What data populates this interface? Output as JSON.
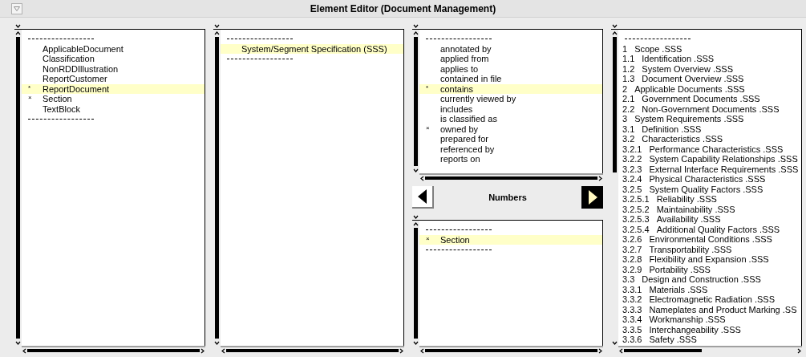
{
  "window": {
    "title": "Element Editor (Document Management)"
  },
  "element_list": {
    "items": [
      {
        "kind": "separator"
      },
      {
        "kind": "item",
        "text": "ApplicableDocument",
        "selected": false
      },
      {
        "kind": "item",
        "text": "Classification",
        "selected": false
      },
      {
        "kind": "item",
        "text": "NonRDDIllustration",
        "selected": false
      },
      {
        "kind": "item",
        "text": "ReportCustomer",
        "selected": false
      },
      {
        "kind": "item",
        "text": "ReportDocument",
        "marker": "*",
        "selected": true
      },
      {
        "kind": "item",
        "text": "Section",
        "marker": "×",
        "selected": false
      },
      {
        "kind": "item",
        "text": "TextBlock",
        "selected": false
      },
      {
        "kind": "separator"
      }
    ]
  },
  "instance_list": {
    "items": [
      {
        "kind": "separator"
      },
      {
        "kind": "item",
        "text": "System/Segment Specification (SSS)",
        "selected": true
      },
      {
        "kind": "separator"
      }
    ]
  },
  "relation_list": {
    "items": [
      {
        "kind": "separator"
      },
      {
        "kind": "item",
        "text": "annotated by",
        "selected": false
      },
      {
        "kind": "item",
        "text": "applied from",
        "selected": false
      },
      {
        "kind": "item",
        "text": "applies to",
        "selected": false
      },
      {
        "kind": "item",
        "text": "contained in file",
        "selected": false
      },
      {
        "kind": "item",
        "text": "contains",
        "marker": "*",
        "selected": true
      },
      {
        "kind": "item",
        "text": "currently viewed by",
        "selected": false
      },
      {
        "kind": "item",
        "text": "includes",
        "selected": false
      },
      {
        "kind": "item",
        "text": "is classified as",
        "selected": false
      },
      {
        "kind": "item",
        "text": "owned by",
        "marker": "×",
        "selected": false
      },
      {
        "kind": "item",
        "text": "prepared for",
        "selected": false
      },
      {
        "kind": "item",
        "text": "referenced by",
        "selected": false
      },
      {
        "kind": "item",
        "text": "reports on",
        "selected": false
      }
    ]
  },
  "navigator": {
    "label": "Numbers"
  },
  "target_type_list": {
    "items": [
      {
        "kind": "separator"
      },
      {
        "kind": "item",
        "text": "Section",
        "marker": "×",
        "selected": true
      },
      {
        "kind": "separator"
      }
    ]
  },
  "section_list": {
    "items": [
      {
        "kind": "separator"
      },
      {
        "kind": "section",
        "number": "1",
        "text": "Scope .SSS"
      },
      {
        "kind": "section",
        "number": "1.1",
        "text": "Identification .SSS"
      },
      {
        "kind": "section",
        "number": "1.2",
        "text": "System Overview .SSS"
      },
      {
        "kind": "section",
        "number": "1.3",
        "text": "Document Overview .SSS"
      },
      {
        "kind": "section",
        "number": "2",
        "text": "Applicable Documents .SSS"
      },
      {
        "kind": "section",
        "number": "2.1",
        "text": "Government Documents .SSS"
      },
      {
        "kind": "section",
        "number": "2.2",
        "text": "Non-Government Documents .SSS"
      },
      {
        "kind": "section",
        "number": "3",
        "text": "System Requirements .SSS"
      },
      {
        "kind": "section",
        "number": "3.1",
        "text": "Definition .SSS"
      },
      {
        "kind": "section",
        "number": "3.2",
        "text": "Characteristics .SSS"
      },
      {
        "kind": "section",
        "number": "3.2.1",
        "text": "Performance Characteristics .SSS"
      },
      {
        "kind": "section",
        "number": "3.2.2",
        "text": "System Capability Relationships .SSS"
      },
      {
        "kind": "section",
        "number": "3.2.3",
        "text": "External Interface Requirements .SSS"
      },
      {
        "kind": "section",
        "number": "3.2.4",
        "text": "Physical Characteristics .SSS"
      },
      {
        "kind": "section",
        "number": "3.2.5",
        "text": "System Quality Factors .SSS"
      },
      {
        "kind": "section",
        "number": "3.2.5.1",
        "text": "Reliability .SSS"
      },
      {
        "kind": "section",
        "number": "3.2.5.2",
        "text": "Maintainability .SSS"
      },
      {
        "kind": "section",
        "number": "3.2.5.3",
        "text": "Availability .SSS"
      },
      {
        "kind": "section",
        "number": "3.2.5.4",
        "text": "Additional Quality Factors .SSS"
      },
      {
        "kind": "section",
        "number": "3.2.6",
        "text": "Environmental Conditions .SSS"
      },
      {
        "kind": "section",
        "number": "3.2.7",
        "text": "Transportability .SSS"
      },
      {
        "kind": "section",
        "number": "3.2.8",
        "text": "Flexibility and Expansion .SSS"
      },
      {
        "kind": "section",
        "number": "3.2.9",
        "text": "Portability .SSS"
      },
      {
        "kind": "section",
        "number": "3.3",
        "text": "Design and Construction .SSS"
      },
      {
        "kind": "section",
        "number": "3.3.1",
        "text": "Materials .SSS"
      },
      {
        "kind": "section",
        "number": "3.3.2",
        "text": "Electromagnetic Radiation .SSS"
      },
      {
        "kind": "section",
        "number": "3.3.3",
        "text": "Nameplates and Product Marking .SS"
      },
      {
        "kind": "section",
        "number": "3.3.4",
        "text": "Workmanship .SSS"
      },
      {
        "kind": "section",
        "number": "3.3.5",
        "text": "Interchangeability .SSS"
      },
      {
        "kind": "section",
        "number": "3.3.6",
        "text": "Safety .SSS"
      }
    ]
  }
}
